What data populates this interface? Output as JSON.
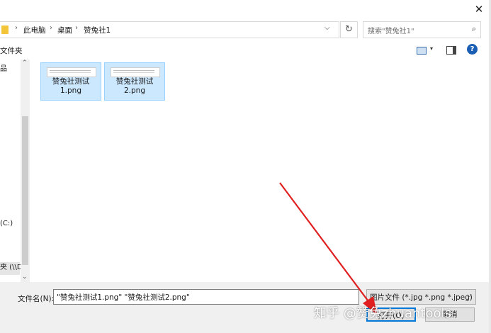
{
  "titlebar": {
    "close_glyph": "✕"
  },
  "address": {
    "crumbs": [
      "此电脑",
      "桌面",
      "赞兔社1"
    ],
    "separator": "›",
    "dropdown_glyph": "⌵",
    "refresh_glyph": "↻"
  },
  "search": {
    "placeholder": "搜索\"赞兔社1\"",
    "icon": "search-icon",
    "glyph": "⌕"
  },
  "toolbar": {
    "new_folder_label": "文件夹",
    "view_dropdown_glyph": "▾",
    "help_glyph": "?"
  },
  "nav": {
    "items": [
      {
        "label": "品"
      },
      {
        "label": "(C:)"
      },
      {
        "label": "夹 (\\\\D:"
      }
    ],
    "scroll_up": "⌃",
    "scroll_down": "⌄"
  },
  "files": [
    {
      "name_line1": "赞兔社测试",
      "name_line2": "1.png"
    },
    {
      "name_line1": "赞兔社测试",
      "name_line2": "2.png"
    }
  ],
  "bottom": {
    "filename_label": "文件名(N):",
    "filename_value": "\"赞兔社测试1.png\" \"赞兔社测试2.png\"",
    "filename_dd": "⌵",
    "filetype_value": "图片文件 (*.jpg *.png *.jpeg)",
    "filetype_dd": "⌵",
    "open_label": "打开(O)",
    "cancel_label": "取消"
  },
  "watermark": {
    "text": "知乎 @赞兔zhuantools"
  },
  "colors": {
    "arrow": "#e02020",
    "selection": "#cce8ff",
    "accent": "#0078d7"
  }
}
